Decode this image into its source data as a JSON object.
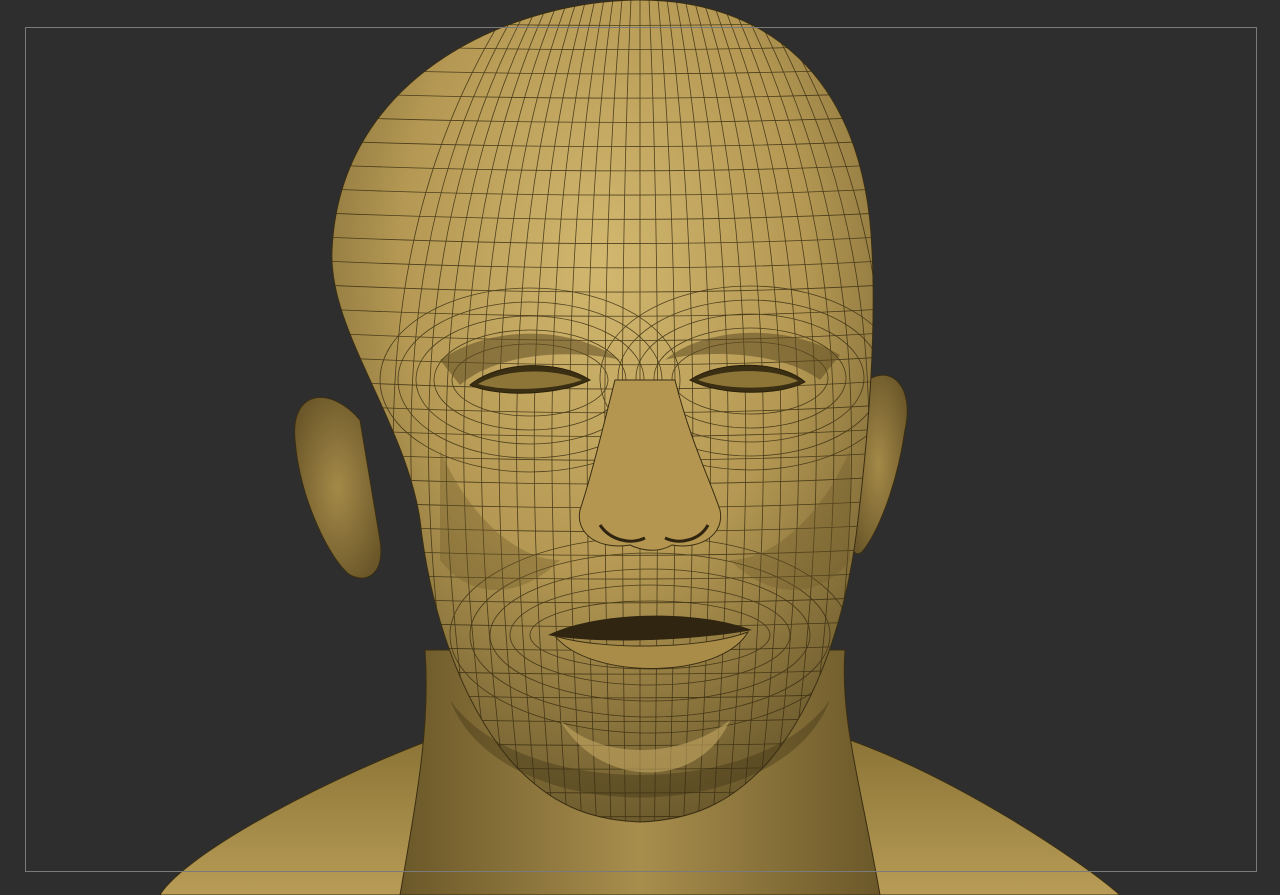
{
  "viewport": {
    "background_color": "#2e2e2f",
    "frame_color": "#7a7a7a"
  },
  "model": {
    "subject": "head-bust",
    "material_color": "#c2a660",
    "wireframe": true,
    "wire_color": "#3a2e12"
  }
}
